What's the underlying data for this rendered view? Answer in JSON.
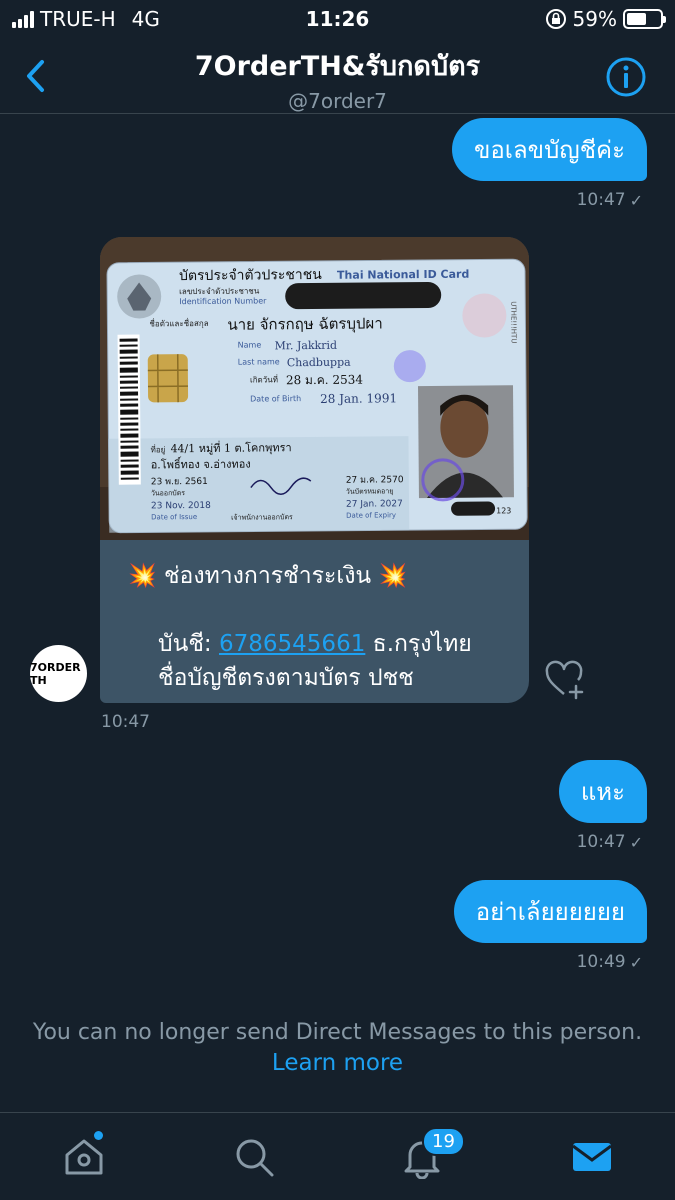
{
  "status_bar": {
    "carrier": "TRUE-H",
    "network": "4G",
    "time": "11:26",
    "battery": "59%",
    "battery_level": 0.59
  },
  "header": {
    "title": "7OrderTH&รับกดบัตร",
    "handle": "@7order7"
  },
  "messages": [
    {
      "text": "ขอเลขบัญชีค่ะ",
      "time": "10:47"
    },
    {
      "text": "แหะ",
      "time": "10:47"
    },
    {
      "text": "อย่าเล้ยยยยยย",
      "time": "10:49"
    }
  ],
  "card": {
    "line1": "💥 ช่องทางการชำระเงิน 💥",
    "account_label": "บันชี: ",
    "account_number": "6786545661",
    "bank": " ธ.กรุงไทย",
    "line3": "ชื่อบัญชีตรงตามบัตร ปชช",
    "time": "10:47",
    "avatar_text": "7ORDER TH",
    "id_card": {
      "heading_th": "บัตรประจำตัวประชาชน",
      "heading_en": "Thai National ID Card",
      "id_label_th": "เลขประจำตัวประชาชน",
      "id_label_en": "Identification Number",
      "name_label": "ชื่อตัวและชื่อสกุล",
      "name_th": "นาย จักรกฤษ ฉัตรบุปผา",
      "name_en_label": "Name",
      "name_en": "Mr. Jakkrid",
      "lastname_label": "Last name",
      "lastname_en": "Chadbuppa",
      "dob_th_label": "เกิดวันที่",
      "dob_th": "28 ม.ค. 2534",
      "dob_en_label": "Date of Birth",
      "dob_en": "28 Jan. 1991",
      "address_label": "ที่อยู่",
      "address1": "44/1 หมู่ที่ 1 ต.โคกพุทรา",
      "address2": "อ.โพธิ์ทอง จ.อ่างทอง",
      "issue_th": "23 พ.ย. 2561",
      "issue_th_label": "วันออกบัตร",
      "issue_en": "23 Nov. 2018",
      "issue_en_label": "Date of Issue",
      "officer_label": "เจ้าพนักงานออกบัตร",
      "expiry_th": "27 ม.ค. 2570",
      "expiry_th_label": "วันบัตรหมดอายุ",
      "expiry_en": "27 Jan. 2027",
      "expiry_en_label": "Date of Expiry",
      "side_text": "UTHE!!!HTU",
      "serial": "123"
    }
  },
  "notice": {
    "text": "You can no longer send Direct Messages to this person.",
    "link": "Learn more"
  },
  "tabbar": {
    "notifications_count": "19"
  },
  "colors": {
    "background": "#15202b",
    "accent": "#1da1f2",
    "muted": "#8899a6",
    "card": "#3d5466"
  }
}
